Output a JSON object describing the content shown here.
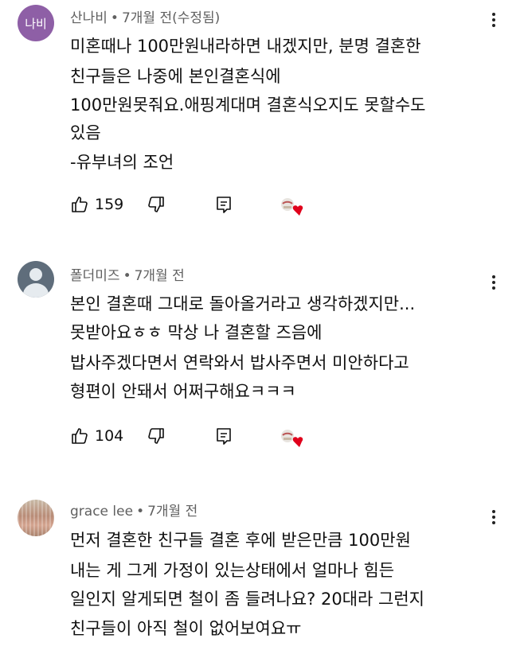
{
  "comments": [
    {
      "avatar_text": "나비",
      "author": "산나비",
      "separator": "•",
      "time": "7개월 전(수정됨)",
      "lines": [
        "미혼때나 100만원내라하면 내겠지만, 분명 결혼한",
        "친구들은 나중에 본인결혼식에",
        "100만원못줘요.애핑계대며 결혼식오지도 못할수도",
        "있음",
        "-유부녀의 조언"
      ],
      "likes": "159"
    },
    {
      "author": "폴더미즈",
      "separator": "•",
      "time": "7개월 전",
      "lines": [
        "본인 결혼때 그대로 돌아올거라고 생각하겠지만...",
        "못받아요ㅎㅎ 막상 나 결혼할 즈음에",
        "밥사주겠다면서 연락와서 밥사주면서 미안하다고",
        "형편이 안돼서 어쩌구해요ㅋㅋㅋ"
      ],
      "likes": "104"
    },
    {
      "author": "grace lee",
      "separator": "•",
      "time": "7개월 전",
      "lines": [
        "먼저 결혼한 친구들 결혼 후에 받은만큼 100만원",
        "내는 게 그게 가정이 있는상태에서 얼마나 힘든",
        "일인지 알게되면 철이 좀 들려나요? 20대라 그런지",
        "친구들이 아직 철이 없어보여요ㅠ"
      ]
    }
  ],
  "icons": {
    "like": "thumbs-up-icon",
    "dislike": "thumbs-down-icon",
    "reply": "reply-icon",
    "more": "more-vertical-icon",
    "creator_heart": "creator-heart-icon"
  },
  "colors": {
    "meta_text": "#606060",
    "heart": "#e0001b",
    "avatar_1": "#8e5fa6",
    "avatar_2": "#5f6d7b"
  }
}
